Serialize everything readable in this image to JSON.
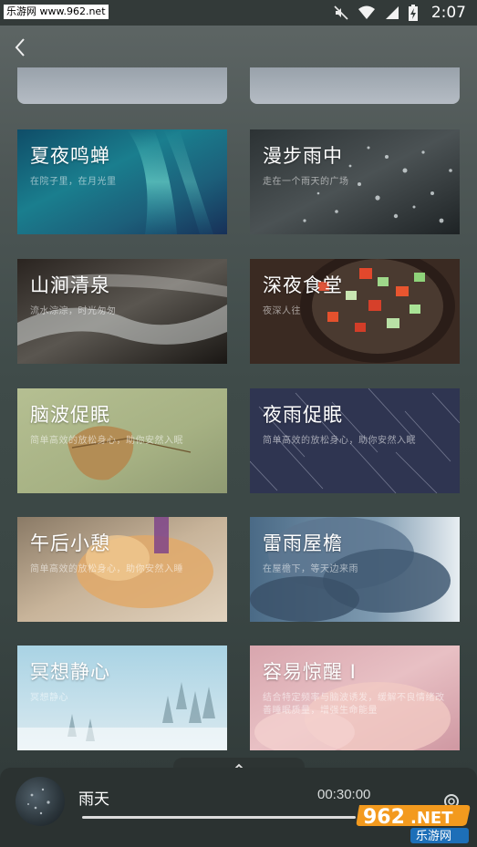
{
  "status_bar": {
    "watermark": "乐游网 www.962.net",
    "time": "2:07",
    "icons": [
      "mute-icon",
      "wifi-icon",
      "signal-icon",
      "battery-charging-icon"
    ]
  },
  "header": {
    "back_icon": "back-chevron-icon"
  },
  "cards": [
    {
      "title": "夏夜鸣蝉",
      "subtitle": "在院子里，在月光里"
    },
    {
      "title": "漫步雨中",
      "subtitle": "走在一个雨天的广场"
    },
    {
      "title": "山涧清泉",
      "subtitle": "流水淙淙，时光匆匆"
    },
    {
      "title": "深夜食堂",
      "subtitle": "夜深人往"
    },
    {
      "title": "脑波促眠",
      "subtitle": "简单高效的放松身心，助你安然入眠"
    },
    {
      "title": "夜雨促眠",
      "subtitle": "简单高效的放松身心，助你安然入眠"
    },
    {
      "title": "午后小憩",
      "subtitle": "简单高效的放松身心，助你安然入睡"
    },
    {
      "title": "雷雨屋檐",
      "subtitle": "在屋檐下，等天边来雨"
    },
    {
      "title": "冥想静心",
      "subtitle": "冥想静心"
    },
    {
      "title": "容易惊醒 Ⅰ",
      "subtitle": "结合特定频率与脑波诱发，缓解不良情绪改善睡眠质量，增强生命能量"
    }
  ],
  "player": {
    "title": "雨天",
    "time": "00:30:00",
    "progress": 0.0,
    "expand_icon": "chevron-up-icon",
    "settings_icon": "gear-icon"
  },
  "logo": {
    "text_962": "962",
    "text_net": ".NET",
    "text_cn": "乐游网"
  },
  "colors": {
    "accent_orange": "#f39a1e",
    "player_bg": "#2b3231"
  }
}
